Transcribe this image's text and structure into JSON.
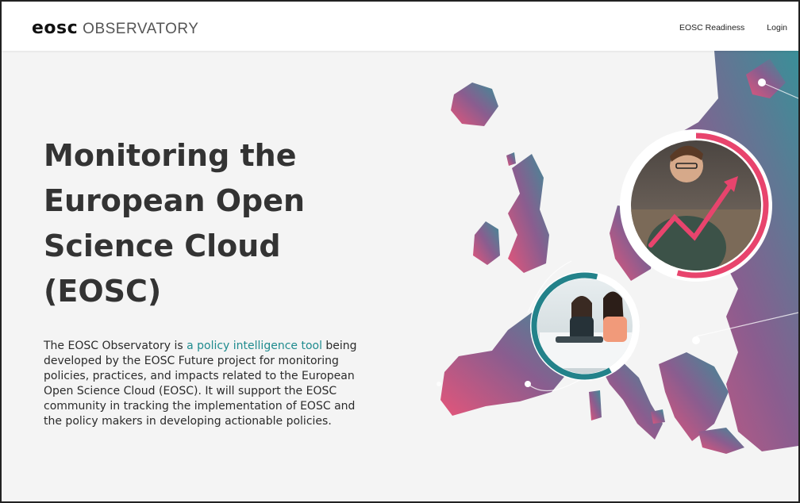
{
  "header": {
    "logo_mark": "eosc",
    "logo_text": "OBSERVATORY",
    "nav": [
      {
        "label": "EOSC Readiness"
      },
      {
        "label": "Login"
      }
    ]
  },
  "hero": {
    "title": "Monitoring the\nEuropean Open\nScience Cloud\n(EOSC)",
    "desc_before": "The EOSC Observatory is ",
    "desc_link": "a policy intelligence tool",
    "desc_after": " being developed by the EOSC Future project for monitoring policies, practices, and impacts related to the European Open Science Cloud (EOSC). It will support the EOSC community in tracking the implementation of EOSC and the policy makers in developing actionable policies."
  },
  "illustration": {
    "map": "europe-map",
    "photo_large": "man-writing-with-chart-arrow",
    "photo_small": "two-women-meeting",
    "colors": {
      "pink": "#e4557a",
      "purple": "#8a5d8f",
      "teal": "#3a8f98",
      "ring_red": "#e8446d",
      "ring_teal": "#23828a"
    }
  }
}
